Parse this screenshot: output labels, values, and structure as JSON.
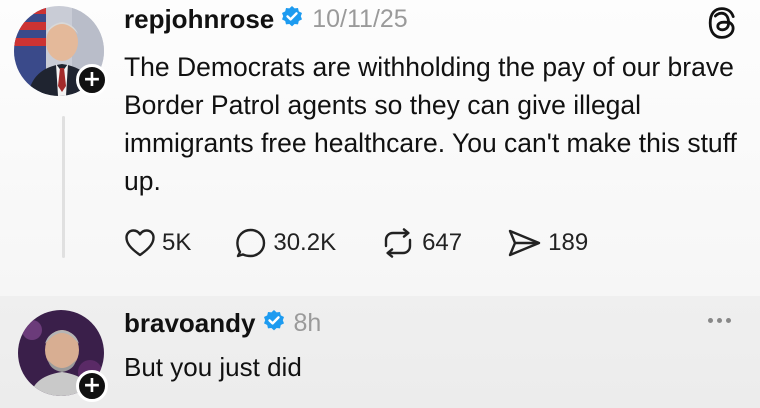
{
  "post": {
    "username": "repjohnrose",
    "timestamp": "10/11/25",
    "text": "The Democrats are withholding the pay of our brave Border Patrol agents so they can give illegal immigrants free healthcare. You can't make this stuff up.",
    "actions": {
      "likes": "5K",
      "replies": "30.2K",
      "reposts": "647",
      "shares": "189"
    },
    "add_icon_glyph": "+"
  },
  "reply": {
    "username": "bravoandy",
    "timestamp": "8h",
    "text": "But you just did",
    "add_icon_glyph": "+"
  },
  "icons": {
    "verified": "verified-badge-icon",
    "threads": "threads-logo-icon",
    "like": "heart-icon",
    "reply": "speech-bubble-icon",
    "repost": "repost-icon",
    "share": "send-icon",
    "more": "more-options-icon"
  },
  "colors": {
    "verified_blue": "#1d9bf0",
    "muted_text": "#9a9a9a"
  }
}
